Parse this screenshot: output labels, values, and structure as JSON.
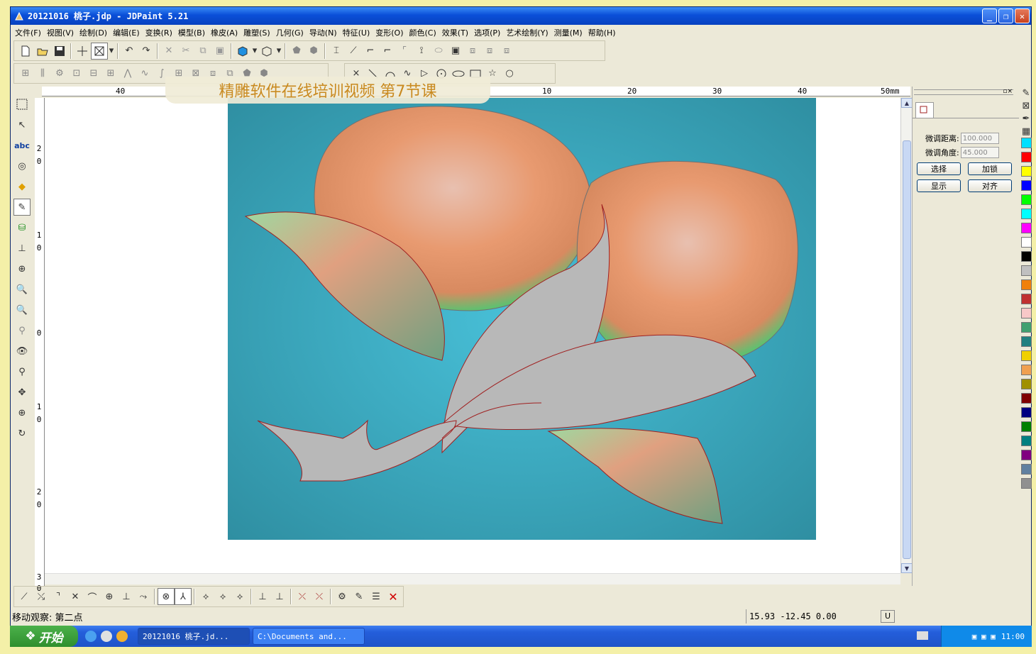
{
  "window": {
    "title": "20121016 桃子.jdp - JDPaint 5.21"
  },
  "menu": [
    "文件(F)",
    "视图(V)",
    "绘制(D)",
    "编辑(E)",
    "变换(R)",
    "模型(B)",
    "橡皮(A)",
    "雕塑(S)",
    "几何(G)",
    "导动(N)",
    "特征(U)",
    "变形(O)",
    "颜色(C)",
    "效果(T)",
    "选项(P)",
    "艺术绘制(Y)",
    "测量(M)",
    "帮助(H)"
  ],
  "banner": "精雕软件在线培训视频  第7节课",
  "ruler": {
    "top": [
      {
        "label": "40"
      },
      {
        "label": "10"
      },
      {
        "label": "20"
      },
      {
        "label": "30"
      },
      {
        "label": "40"
      },
      {
        "label": "50mm"
      }
    ],
    "left": [
      "2",
      "0",
      "1",
      "0",
      "0",
      "1",
      "0",
      "2",
      "0",
      "3",
      "0"
    ]
  },
  "panel": {
    "distance_label": "微调距离",
    "distance_value": "100.000",
    "angle_label": "微调角度",
    "angle_value": "45.000",
    "btn_select": "选择",
    "btn_lock": "加锁",
    "btn_show": "显示",
    "btn_align": "对齐"
  },
  "palette": [
    "#00e0ff",
    "#ff0000",
    "#ffff00",
    "#0000ff",
    "#00ff00",
    "#00ffff",
    "#ff00ff",
    "#ffffff",
    "#000000",
    "#c0c0c0",
    "#f0800a",
    "#c03030",
    "#f8c8c8",
    "#40a070",
    "#208080",
    "#f0d000",
    "#f0a050",
    "#a09000",
    "#800000",
    "#000080",
    "#008000",
    "#008080",
    "#800080",
    "#6080a0",
    "#909090"
  ],
  "status": {
    "message": "移动观察: 第二点",
    "coords": "15.93  -12.45  0.00",
    "mode": "U"
  },
  "taskbar": {
    "start": "开始",
    "task1": "20121016 桃子.jd...",
    "task2": "C:\\Documents and...",
    "clock": "11:00"
  }
}
